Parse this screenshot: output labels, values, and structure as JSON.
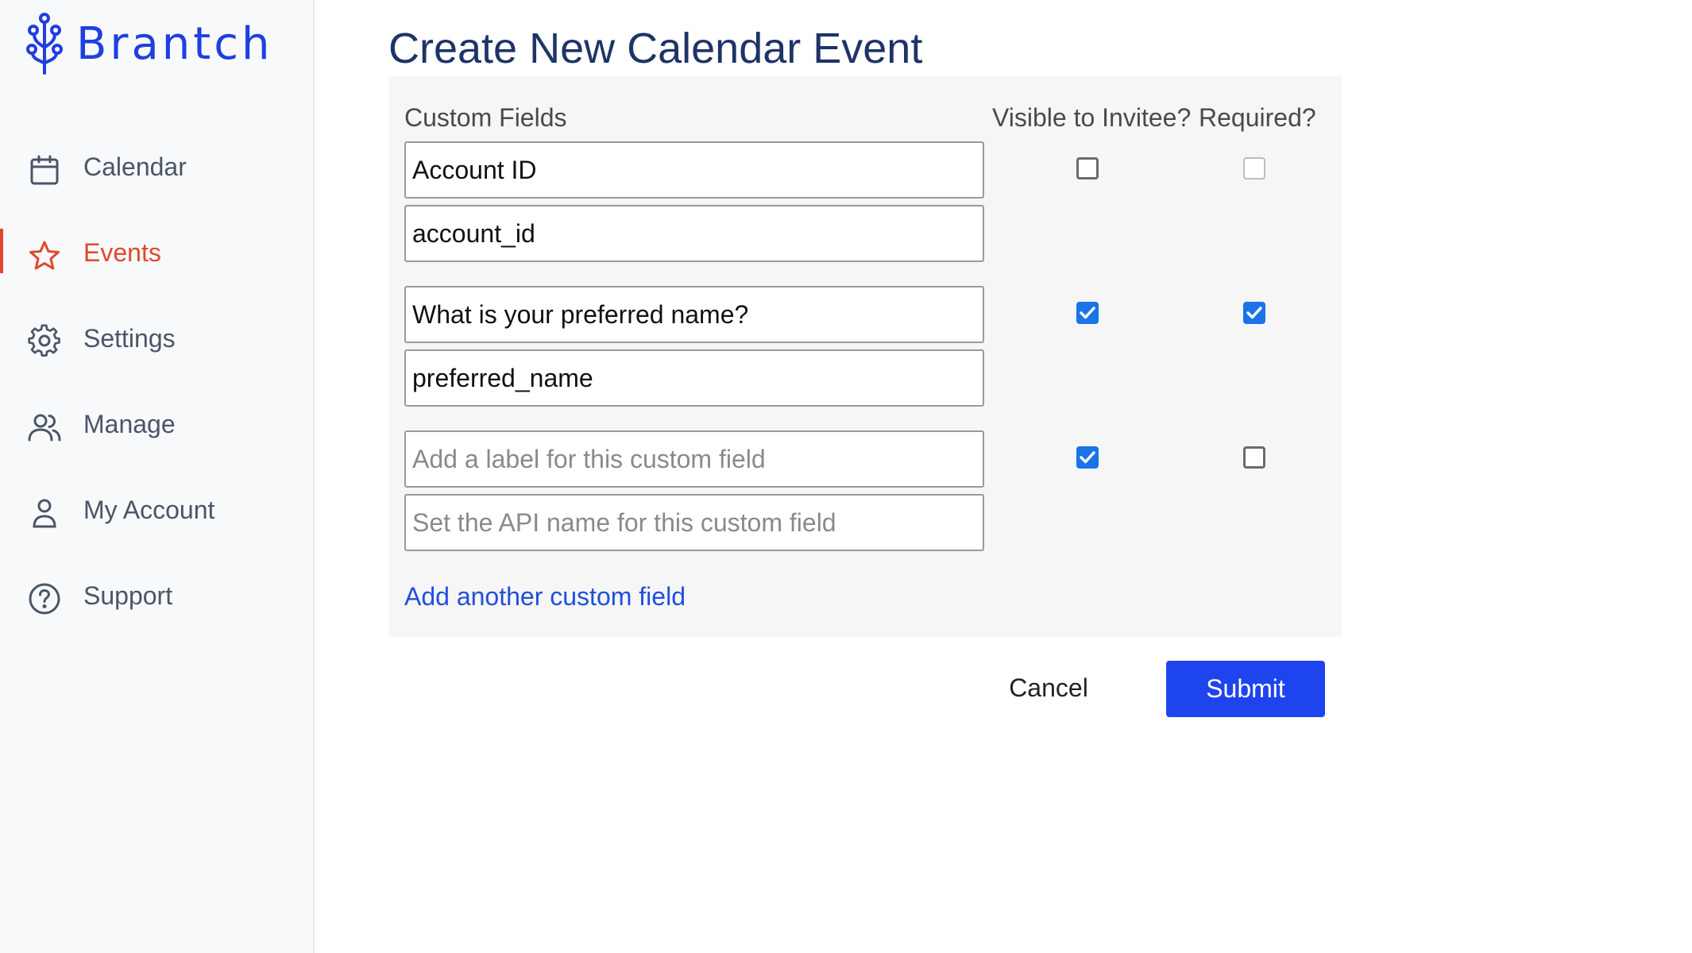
{
  "brand": {
    "name": "Brantch",
    "logo_icon": "branch-logo-icon",
    "color": "#1f3fe0"
  },
  "sidebar": {
    "items": [
      {
        "label": "Calendar",
        "icon": "calendar-icon",
        "active": false
      },
      {
        "label": "Events",
        "icon": "star-icon",
        "active": true
      },
      {
        "label": "Settings",
        "icon": "gear-icon",
        "active": false
      },
      {
        "label": "Manage",
        "icon": "users-icon",
        "active": false
      },
      {
        "label": "My Account",
        "icon": "user-icon",
        "active": false
      },
      {
        "label": "Support",
        "icon": "help-circle-icon",
        "active": false
      }
    ],
    "active_color": "#e0482e"
  },
  "page": {
    "title": "Create New Calendar Event"
  },
  "custom_fields": {
    "headers": {
      "fields": "Custom Fields",
      "visible": "Visible to Invitee?",
      "required": "Required?"
    },
    "rows": [
      {
        "label_value": "Account ID",
        "api_name_value": "account_id",
        "visible_to_invitee": false,
        "required": false,
        "required_disabled": true
      },
      {
        "label_value": "What is your preferred name?",
        "api_name_value": "preferred_name",
        "visible_to_invitee": true,
        "required": true,
        "required_disabled": false
      },
      {
        "label_value": "",
        "label_placeholder": "Add a label for this custom field",
        "api_name_value": "",
        "api_name_placeholder": "Set the API name for this custom field",
        "visible_to_invitee": true,
        "required": false,
        "required_disabled": false
      }
    ],
    "add_link": "Add another custom field"
  },
  "actions": {
    "cancel": "Cancel",
    "submit": "Submit",
    "submit_color": "#1e44ee"
  }
}
